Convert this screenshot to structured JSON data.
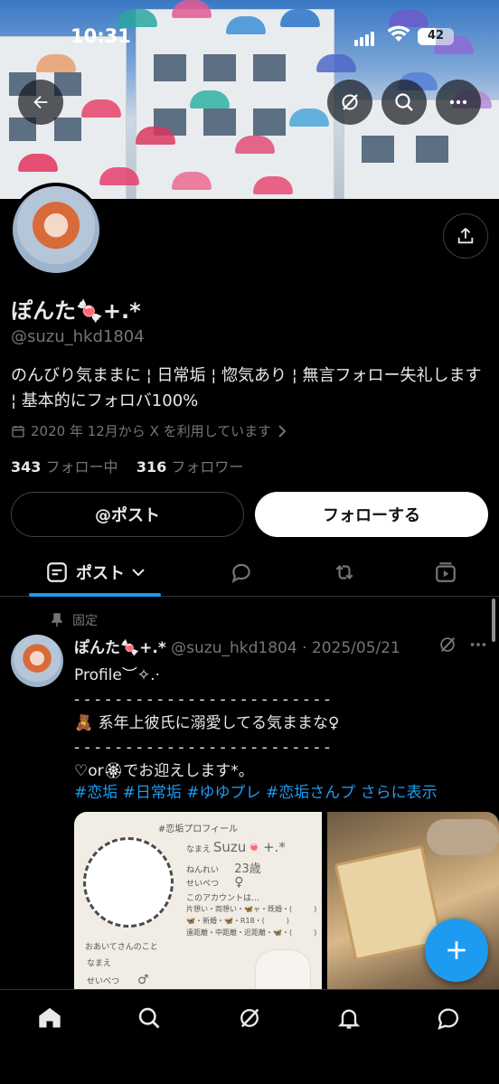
{
  "status_bar": {
    "time": "10:31",
    "battery": "42"
  },
  "colors": {
    "accent": "#1d9bf0",
    "background": "#000000",
    "text": "#e7e9ea",
    "muted": "#71767b",
    "border": "#2f3336"
  },
  "header": {
    "icons": [
      "back-arrow-icon",
      "grok-icon",
      "search-icon",
      "more-icon"
    ]
  },
  "profile": {
    "name": "ぽんた🍬+.*",
    "handle": "@suzu_hkd1804",
    "bio": "のんびり気ままに ¦ 日常垢 ¦ 惚気あり ¦ 無言フォロー失礼します ¦ 基本的にフォロバ100%",
    "joined": "2020 年 12月から X を利用しています",
    "following_count": "343",
    "following_label": "フォロー中",
    "followers_count": "316",
    "followers_label": "フォロワー"
  },
  "actions": {
    "post_label": "@ポスト",
    "follow_label": "フォローする"
  },
  "tabs": {
    "active_label": "ポスト",
    "icons": [
      "posts-icon",
      "replies-icon",
      "repost-icon",
      "media-icon"
    ]
  },
  "pinned_post": {
    "pinned_label": "固定",
    "author": "ぽんた🍬+.*",
    "handle": "@suzu_hkd1804",
    "date": "2025/05/21",
    "meta": "@suzu_hkd1804 · 2025/05/21",
    "body": "Profile︶✧.·\n- - - - - - - - - - - - - - - - - - - - - - - - -\n🧸 系年上彼氏に溺愛してる気ままな♀\n- - - - - - - - - - - - - - - - - - - - - - - - -\n♡or🏵でお迎えします*。",
    "tags": "#恋垢 #日常垢 #ゆゆプレ #恋垢さんプ",
    "show_more": "さらに表示",
    "card": {
      "title": "#恋垢プロフィール",
      "name_label": "なまえ",
      "name_value": "Suzu🍬+.*",
      "age_label": "ねんれい",
      "age_value": "23歳",
      "gender_label": "せいべつ",
      "gender_value": "♀",
      "account_label": "このアカウントは…",
      "account_line1": "片想い・両想い・🦋ャ・既婚・(　　　)",
      "account_line2": "🦋・新婚・🦋・R18・(　　　)",
      "account_line3": "遠距離・中距離・近距離・🦋・(　　　)",
      "partner_label": "おあいてさんのこと",
      "partner_name": "なまえ",
      "partner_gender": "せいべつ",
      "partner_gender_value": "♂"
    }
  },
  "bottom_nav": [
    "home-icon",
    "search-icon",
    "grok-icon",
    "notifications-icon",
    "messages-icon"
  ]
}
